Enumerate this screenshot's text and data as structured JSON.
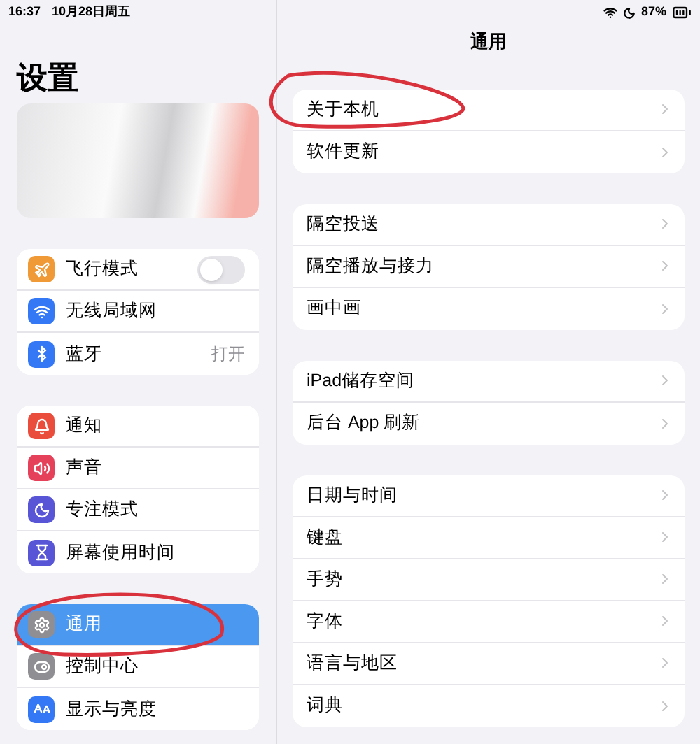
{
  "status_bar": {
    "time": "16:37",
    "date": "10月28日周五",
    "battery": "87%"
  },
  "sidebar": {
    "title": "设置",
    "groups": [
      [
        {
          "label": "飞行模式",
          "color": "#f09a37",
          "kind": "toggle",
          "on": false,
          "selected": false
        },
        {
          "label": "无线局域网",
          "color": "#3478f6",
          "kind": "plain",
          "selected": false
        },
        {
          "label": "蓝牙",
          "color": "#3478f6",
          "kind": "value",
          "value": "打开",
          "selected": false
        }
      ],
      [
        {
          "label": "通知",
          "color": "#eb4d3d",
          "kind": "plain",
          "selected": false
        },
        {
          "label": "声音",
          "color": "#e5415a",
          "kind": "plain",
          "selected": false
        },
        {
          "label": "专注模式",
          "color": "#5856d6",
          "kind": "plain",
          "selected": false
        },
        {
          "label": "屏幕使用时间",
          "color": "#5856d6",
          "kind": "plain",
          "selected": false
        }
      ],
      [
        {
          "label": "通用",
          "color": "#8e8e93",
          "kind": "plain",
          "selected": true
        },
        {
          "label": "控制中心",
          "color": "#8e8e93",
          "kind": "plain",
          "selected": false
        },
        {
          "label": "显示与亮度",
          "color": "#3478f6",
          "kind": "plain",
          "selected": false
        }
      ]
    ]
  },
  "detail": {
    "title": "通用",
    "groups": [
      [
        {
          "label": "关于本机"
        },
        {
          "label": "软件更新"
        }
      ],
      [
        {
          "label": "隔空投送"
        },
        {
          "label": "隔空播放与接力"
        },
        {
          "label": "画中画"
        }
      ],
      [
        {
          "label": "iPad储存空间"
        },
        {
          "label": "后台 App 刷新"
        }
      ],
      [
        {
          "label": "日期与时间"
        },
        {
          "label": "键盘"
        },
        {
          "label": "手势"
        },
        {
          "label": "字体"
        },
        {
          "label": "语言与地区"
        },
        {
          "label": "词典"
        }
      ]
    ]
  }
}
